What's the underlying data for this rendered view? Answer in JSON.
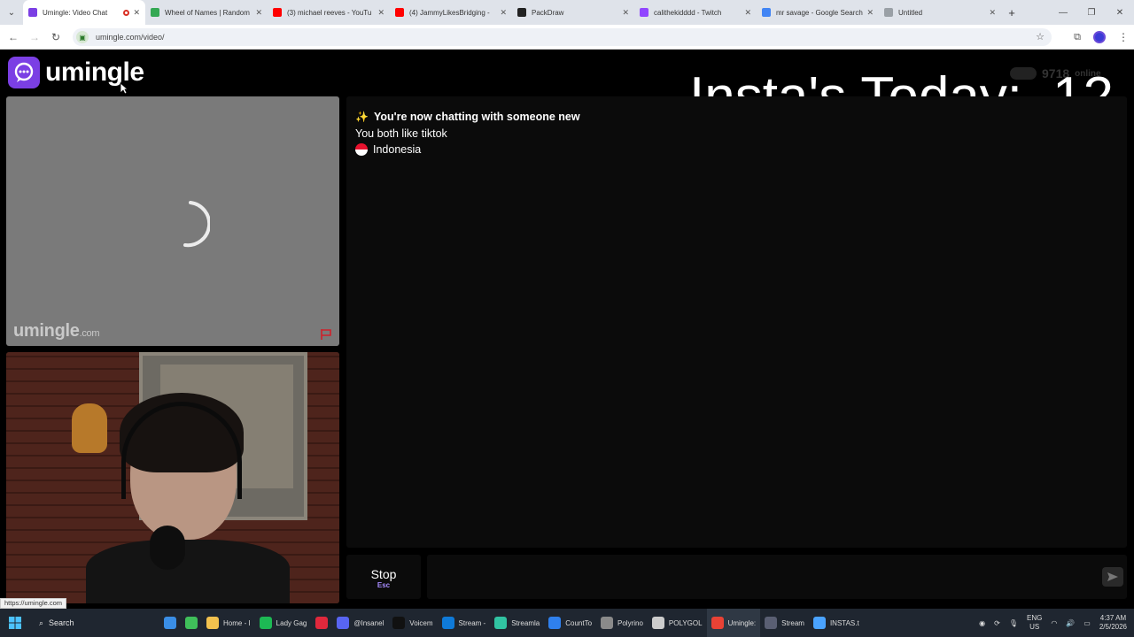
{
  "browser": {
    "tabs": [
      {
        "label": "Umingle: Video Chat",
        "color": "#7b3fe4",
        "active": true
      },
      {
        "label": "Wheel of Names | Random",
        "color": "#34a853"
      },
      {
        "label": "(3) michael reeves - YouTu",
        "color": "#ff0000"
      },
      {
        "label": "(4) JammyLikesBridging -",
        "color": "#ff0000"
      },
      {
        "label": "PackDraw",
        "color": "#222222"
      },
      {
        "label": "calithekidddd - Twitch",
        "color": "#9146ff"
      },
      {
        "label": "mr savage - Google Search",
        "color": "#4285f4"
      },
      {
        "label": "Untitled",
        "color": "#9aa0a6"
      }
    ],
    "url": "umingle.com/video/",
    "status_url": "https://umingle.com"
  },
  "page": {
    "logo_text": "umingle",
    "online_count": "9718",
    "online_label": "online",
    "overlay_label": "Insta's Today:",
    "overlay_count": "12",
    "watermark_main": "umingle",
    "watermark_suffix": ".com",
    "chat": {
      "notice": "You're now chatting with someone new",
      "common_interest": "You both like tiktok",
      "country": "Indonesia"
    },
    "stop_label": "Stop",
    "stop_key": "Esc",
    "message_placeholder": ""
  },
  "colors": {
    "brand": "#7b3fe4",
    "report_flag": "#d0202a"
  },
  "taskbar": {
    "search_label": "Search",
    "items": [
      {
        "label": "",
        "color": "#3a8ee6",
        "icon": "file-explorer-icon"
      },
      {
        "label": "",
        "color": "#3fbf5a",
        "icon": "app-icon"
      },
      {
        "label": "Home - I",
        "color": "#f2c14e",
        "icon": "folder-icon"
      },
      {
        "label": "Lady Gag",
        "color": "#1db954",
        "icon": "spotify-icon"
      },
      {
        "label": "",
        "color": "#e0283c",
        "icon": "opera-icon"
      },
      {
        "label": "@Insanel",
        "color": "#5865f2",
        "icon": "discord-icon"
      },
      {
        "label": "Voicem",
        "color": "#111111",
        "icon": "voicemod-icon"
      },
      {
        "label": "Stream -",
        "color": "#0f7ad8",
        "icon": "edge-icon"
      },
      {
        "label": "Streamla",
        "color": "#31c3a2",
        "icon": "streamlabs-icon"
      },
      {
        "label": "CountTo",
        "color": "#2f80ed",
        "icon": "vscode-icon"
      },
      {
        "label": "Polyrino",
        "color": "#8a8a8a",
        "icon": "pen-icon"
      },
      {
        "label": "POLYGOL",
        "color": "#cccccc",
        "icon": "notepad-icon"
      },
      {
        "label": "Umingle:",
        "color": "#e94235",
        "icon": "chrome-icon",
        "active": true
      },
      {
        "label": "Stream",
        "color": "#5a5f73",
        "icon": "obs-icon"
      },
      {
        "label": "INSTAS.t",
        "color": "#4aa3ff",
        "icon": "notepad-icon"
      }
    ],
    "lang_top": "ENG",
    "lang_bottom": "US",
    "time": "4:37 AM",
    "date": "2/5/2026"
  }
}
